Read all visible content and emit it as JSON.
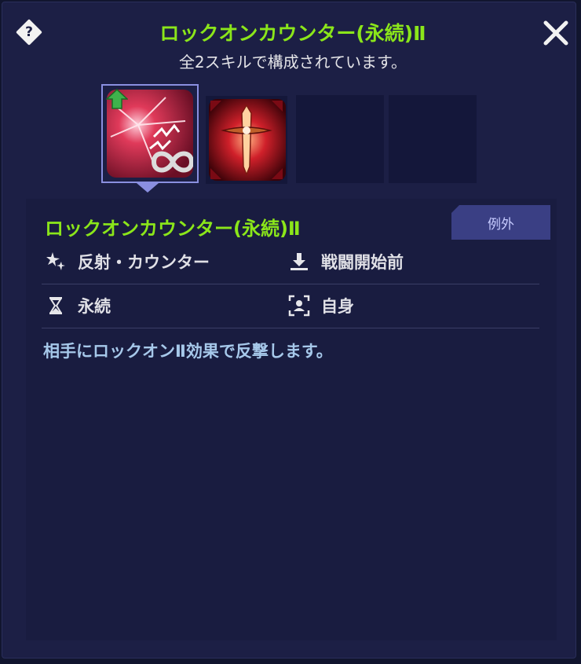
{
  "header": {
    "title": "ロックオンカウンター(永続)Ⅱ",
    "subtitle": "全2スキルで構成されています。"
  },
  "icons": {
    "help": "question-diamond-icon",
    "close": "close-icon"
  },
  "skill_slots": [
    {
      "name": "ロックオンカウンター(永続)Ⅱ",
      "selected": true,
      "art": "crimson-burst-infinity-art",
      "upgrade_badge": "green-up-arrow-icon"
    },
    {
      "name": "",
      "selected": false,
      "art": "crimson-sword-art"
    },
    {
      "name": "",
      "selected": false,
      "art": "empty"
    },
    {
      "name": "",
      "selected": false,
      "art": "empty"
    }
  ],
  "detail": {
    "skill_name": "ロックオンカウンター(永続)Ⅱ",
    "badge": "例外",
    "attributes": {
      "type": "反射・カウンター",
      "timing": "戦闘開始前",
      "duration": "永続",
      "target": "自身"
    },
    "description": "相手にロックオンⅡ効果で反撃します。"
  },
  "colors": {
    "title_green": "#8be61a",
    "panel_bg": "#1c1f45",
    "desc_blue": "#a6c8ea"
  }
}
